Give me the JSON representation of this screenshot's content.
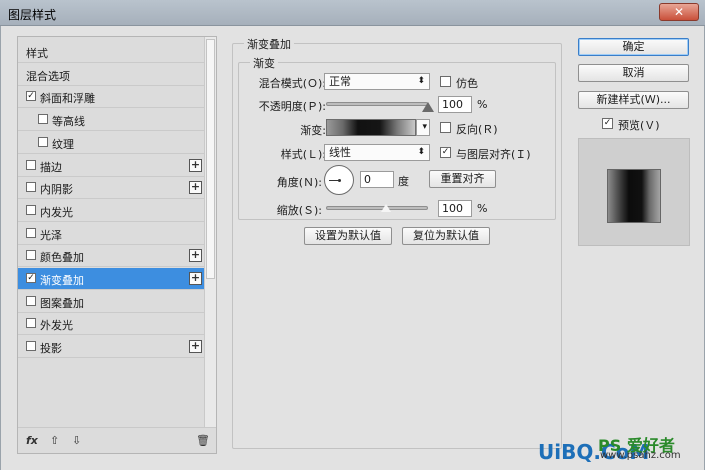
{
  "window": {
    "title": "图层样式",
    "close": "✕"
  },
  "left": {
    "items": [
      {
        "label": "样式",
        "checkbox": false,
        "plus": false,
        "checked": false,
        "indent": 0,
        "selected": false
      },
      {
        "label": "混合选项",
        "checkbox": false,
        "plus": false,
        "checked": false,
        "indent": 0,
        "selected": false
      },
      {
        "label": "斜面和浮雕",
        "checkbox": true,
        "plus": false,
        "checked": true,
        "indent": 0,
        "selected": false
      },
      {
        "label": "等高线",
        "checkbox": true,
        "plus": false,
        "checked": false,
        "indent": 1,
        "selected": false
      },
      {
        "label": "纹理",
        "checkbox": true,
        "plus": false,
        "checked": false,
        "indent": 1,
        "selected": false
      },
      {
        "label": "描边",
        "checkbox": true,
        "plus": true,
        "checked": false,
        "indent": 0,
        "selected": false
      },
      {
        "label": "内阴影",
        "checkbox": true,
        "plus": true,
        "checked": false,
        "indent": 0,
        "selected": false
      },
      {
        "label": "内发光",
        "checkbox": true,
        "plus": false,
        "checked": false,
        "indent": 0,
        "selected": false
      },
      {
        "label": "光泽",
        "checkbox": true,
        "plus": false,
        "checked": false,
        "indent": 0,
        "selected": false
      },
      {
        "label": "颜色叠加",
        "checkbox": true,
        "plus": true,
        "checked": false,
        "indent": 0,
        "selected": false
      },
      {
        "label": "渐变叠加",
        "checkbox": true,
        "plus": true,
        "checked": true,
        "indent": 0,
        "selected": true
      },
      {
        "label": "图案叠加",
        "checkbox": true,
        "plus": false,
        "checked": false,
        "indent": 0,
        "selected": false
      },
      {
        "label": "外发光",
        "checkbox": true,
        "plus": false,
        "checked": false,
        "indent": 0,
        "selected": false
      },
      {
        "label": "投影",
        "checkbox": true,
        "plus": true,
        "checked": false,
        "indent": 0,
        "selected": false
      }
    ],
    "footer": {
      "fx": "fx",
      "up": "⇧",
      "down": "⇩",
      "trash": "🗑"
    }
  },
  "panel": {
    "section_title": "渐变叠加",
    "group_title": "渐变",
    "blend_mode_label": "混合模式(Ｏ):",
    "blend_mode_value": "正常",
    "dither_label": "仿色",
    "opacity_label": "不透明度(Ｐ):",
    "opacity_value": "100",
    "opacity_unit": "%",
    "opacity_level": 1.0,
    "gradient_label": "渐变:",
    "reverse_label": "反向(Ｒ)",
    "style_label": "样式(Ｌ):",
    "style_value": "线性",
    "align_label": "与图层对齐(Ｉ)",
    "angle_label": "角度(Ｎ):",
    "angle_value": "0",
    "angle_unit": "度",
    "reset_align_button": "重置对齐",
    "scale_label": "缩放(Ｓ):",
    "scale_value": "100",
    "scale_unit": "%",
    "scale_level": 0.6,
    "make_default_button": "设置为默认值",
    "reset_default_button": "复位为默认值"
  },
  "right": {
    "ok": "确定",
    "cancel": "取消",
    "new_style": "新建样式(Ｗ)...",
    "preview_label": "预览(Ｖ)",
    "preview_checked": true
  },
  "watermark": {
    "brand": "UiBQ.CoM",
    "ps": "PS 爱好者",
    "site": "www.psahz.com"
  }
}
